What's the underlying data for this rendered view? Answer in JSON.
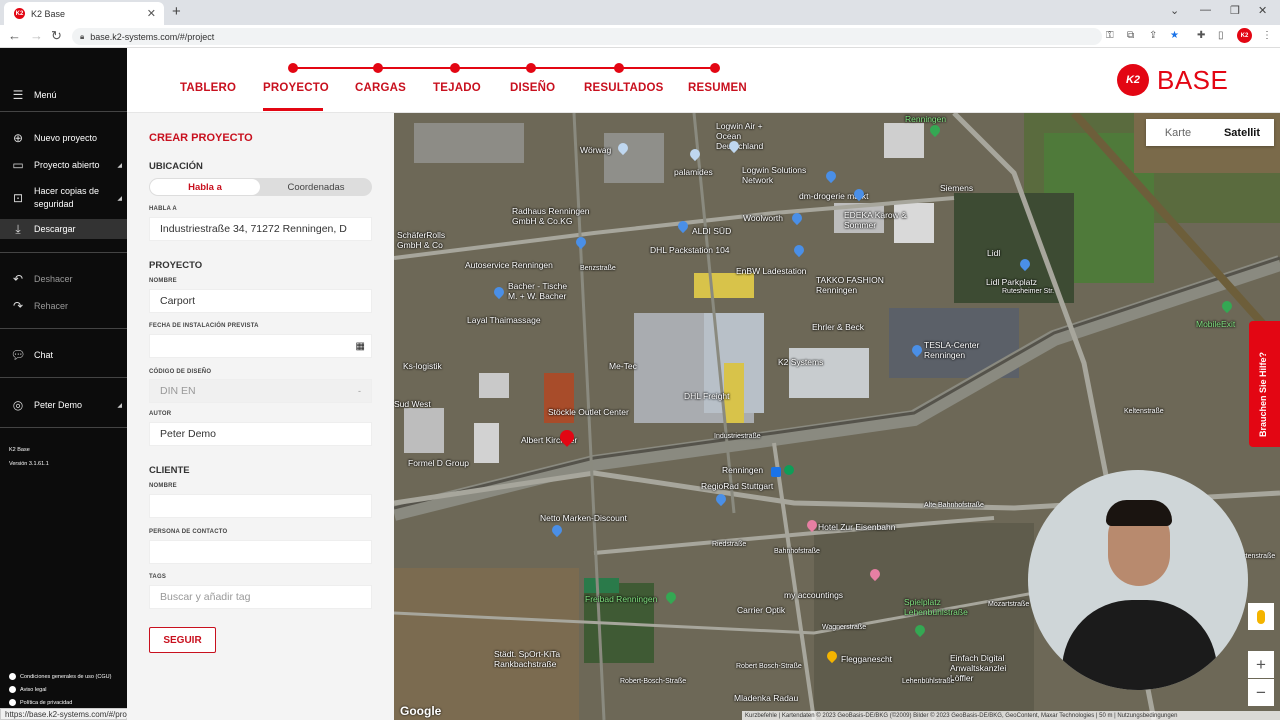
{
  "browser": {
    "tab_title": "K2 Base",
    "favicon": "K2",
    "url": "base.k2-systems.com/#/project",
    "status_url": "https://base.k2-systems.com/#/project"
  },
  "sidebar": {
    "menu": "Menú",
    "items": [
      {
        "label": "Nuevo proyecto",
        "icon": "new-project-icon"
      },
      {
        "label": "Proyecto abierto",
        "icon": "folder-icon"
      },
      {
        "label": "Hacer copias de seguridad",
        "icon": "backup-icon"
      },
      {
        "label": "Descargar",
        "icon": "download-icon"
      },
      {
        "label": "Deshacer",
        "icon": "undo-icon"
      },
      {
        "label": "Rehacer",
        "icon": "redo-icon"
      },
      {
        "label": "Chat",
        "icon": "chat-icon"
      },
      {
        "label": "Peter Demo",
        "icon": "user-icon"
      }
    ],
    "app_name": "K2 Base",
    "version": "Versión 3.1.61.1",
    "legal": [
      "Condiciones generales de uso (CGU)",
      "Aviso legal",
      "Política de privacidad"
    ]
  },
  "steps": [
    "TABLERO",
    "PROYECTO",
    "CARGAS",
    "TEJADO",
    "DISEÑO",
    "RESULTADOS",
    "RESUMEN"
  ],
  "logo": {
    "badge": "K2",
    "word": "BASE"
  },
  "form": {
    "title": "CREAR PROYECTO",
    "ubicacion": "UBICACIÓN",
    "seg_on": "Habla a",
    "seg_off": "Coordenadas",
    "address_label": "HABLA A",
    "address_value": "Industriestraße 34, 71272 Renningen, D",
    "proyecto": "PROYECTO",
    "nombre_label": "NOMBRE",
    "nombre_value": "Carport",
    "fecha_label": "FECHA DE INSTALACIÓN PREVISTA",
    "codigo_label": "CÓDIGO DE DISEÑO",
    "codigo_value": "DIN EN",
    "autor_label": "AUTOR",
    "autor_value": "Peter Demo",
    "cliente": "CLIENTE",
    "cliente_nombre_label": "NOMBRE",
    "contacto_label": "PERSONA DE CONTACTO",
    "tags_label": "TAGS",
    "tags_placeholder": "Buscar y añadir tag",
    "seguir": "SEGUIR"
  },
  "map": {
    "karte": "Karte",
    "satellit": "Satellit",
    "help": "Brauchen Sie Hilfe?",
    "google": "Google",
    "attribution": "Kurzbefehle | Kartendaten © 2023 GeoBasis-DE/BKG (©2009) Bilder © 2023 GeoBasis-DE/BKG, GeoContent, Maxar Technologies | 50 m | Nutzungsbedingungen",
    "labels": [
      "Wörwag",
      "Logwin Air + Ocean Deutschland",
      "palamides",
      "Logwin Solutions Network",
      "dm-drogerie markt",
      "Siemens",
      "Renningen",
      "Radhaus Renningen GmbH & Co.KG",
      "Woolworth",
      "EDEKA Karow & Sommer",
      "ALDI SÜD",
      "SchäferRolls GmbH & Co",
      "DHL Packstation 104",
      "Lidl",
      "Autoservice Renningen",
      "EnBW Ladestation",
      "TAKKO FASHION Renningen",
      "Lidl Parkplatz",
      "Bacher - Tische M. + W. Bacher",
      "Layal Thaimassage",
      "Ehrler & Beck",
      "TESLA-Center Renningen",
      "Me-Tec",
      "K2 Systems",
      "MobileExit",
      "Ks-logistik",
      "DHL Freight",
      "Stöckle Outlet Center",
      "Albert Kirchner",
      "Sud West",
      "Formel D Group",
      "Renningen",
      "RegioRad Stuttgart",
      "Netto Marken-Discount",
      "Hotel Zur Eisenbahn",
      "Freibad Renningen",
      "my accountings",
      "Carrier Optik",
      "Spielplatz Lehenbühlstraße",
      "Städt. SpOrt-KiTa Rankbachstraße",
      "Flegganescht",
      "Einfach Digital Anwaltskanzlei Löffler",
      "Mladenka Radau",
      "Industriestraße",
      "Benzstraße",
      "Alte Bahnhofstraße",
      "Keltenstraße",
      "Riedstraße",
      "Bahnhofstraße",
      "Wagnerstraße",
      "Robert Bosch-Straße",
      "Mozartstraße",
      "Rutesheimer Str.",
      "Robert-Bosch-Straße",
      "Lehenbühlstraße",
      "Gartenstraße"
    ]
  }
}
